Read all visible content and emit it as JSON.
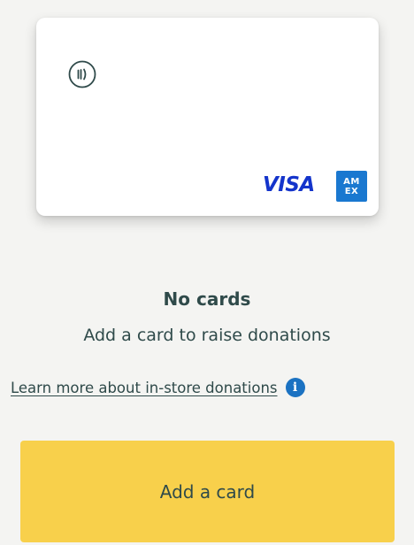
{
  "card": {
    "contactless_icon": "contactless-icon",
    "brand_visa": "VISA",
    "brand_amex_line1": "AM",
    "brand_amex_line2": "EX"
  },
  "empty_state": {
    "title": "No cards",
    "subtitle": "Add a card to raise donations",
    "learn_more_link": "Learn more about in-store donations",
    "info_icon": "info-icon"
  },
  "actions": {
    "add_card_label": "Add a card"
  },
  "colors": {
    "background": "#f4f4f2",
    "text": "#2f4a4a",
    "button": "#f8d04b",
    "visa": "#1434cb",
    "amex": "#1a78d0",
    "info": "#1b72c2"
  }
}
